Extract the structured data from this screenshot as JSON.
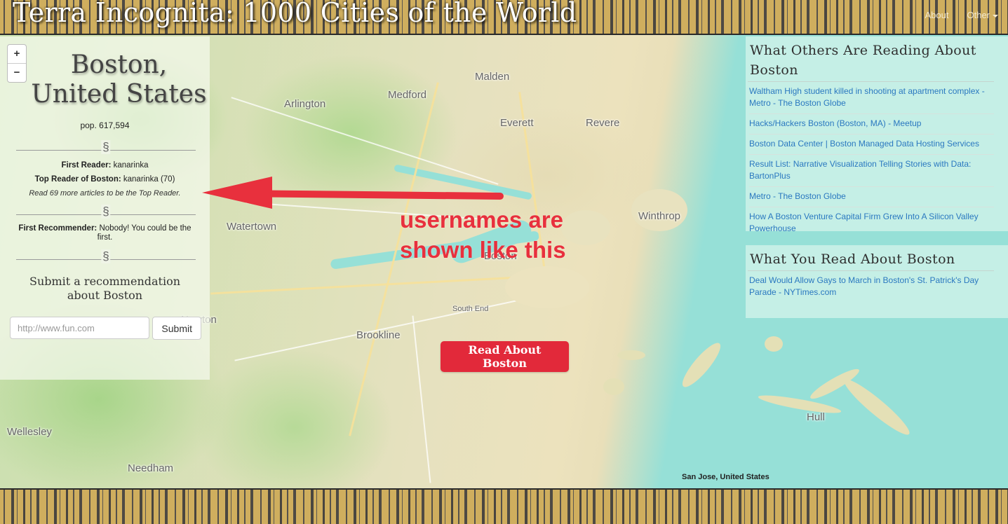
{
  "header": {
    "site_title": "Terra Incognita: 1000 Cities of the World",
    "nav_about": "About",
    "nav_other": "Other"
  },
  "zoom": {
    "plus": "+",
    "minus": "−"
  },
  "city": {
    "name_line1": "Boston,",
    "name_line2": "United States",
    "population": "pop. 617,594"
  },
  "readers": {
    "first_reader_label": "First Reader:",
    "first_reader_value": "kanarinka",
    "top_reader_label": "Top Reader of Boston:",
    "top_reader_value": "kanarinka (70)",
    "hint": "Read 69 more articles to be the Top Reader.",
    "first_recommender_label": "First Recommender:",
    "first_recommender_value": "Nobody! You could be the first."
  },
  "recommend": {
    "title": "Submit a recommendation about Boston",
    "input_placeholder": "http://www.fun.com",
    "submit_label": "Submit"
  },
  "read_button": "Read About Boston",
  "annotation": {
    "line1": "usernames are",
    "line2": "shown like this",
    "color": "#e8303d"
  },
  "others_reading": {
    "title": "What Others Are Reading About Boston",
    "items": [
      "Waltham High student killed in shooting at apartment complex - Metro - The Boston Globe",
      "Hacks/Hackers Boston (Boston, MA) - Meetup",
      "Boston Data Center | Boston Managed Data Hosting Services",
      "Result List: Narrative Visualization Telling Stories with Data: BartonPlus",
      "Metro - The Boston Globe",
      "How A Boston Venture Capital Firm Grew Into A Silicon Valley Powerhouse"
    ]
  },
  "you_read": {
    "title": "What You Read About Boston",
    "items": [
      "Deal Would Allow Gays to March in Boston's St. Patrick's Day Parade - NYTimes.com"
    ]
  },
  "map": {
    "places": [
      "Malden",
      "Medford",
      "Arlington",
      "Everett",
      "Revere",
      "Watertown",
      "Winthrop",
      "Boston",
      "Brookline",
      "Newton",
      "Wellesley",
      "Needham",
      "Hull",
      "South End"
    ],
    "attribution": "San Jose, United States"
  },
  "colors": {
    "accent_red": "#e2293a",
    "link_blue": "#2a78c0",
    "banner_gold": "#cfae5e",
    "panel_aqua": "#ccf0e8"
  }
}
